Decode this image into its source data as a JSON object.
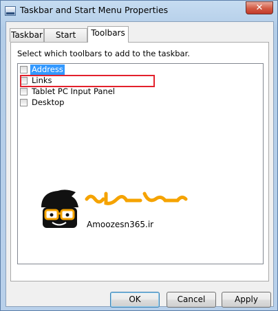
{
  "window": {
    "title": "Taskbar and Start Menu Properties",
    "close_glyph": "✕"
  },
  "tabs": [
    {
      "label": "Taskbar",
      "active": false
    },
    {
      "label": "Start Menu",
      "active": false
    },
    {
      "label": "Toolbars",
      "active": true
    }
  ],
  "toolbars_page": {
    "instruction": "Select which toolbars to add to the taskbar.",
    "items": [
      {
        "label": "Address",
        "checked": false,
        "selected": true
      },
      {
        "label": "Links",
        "checked": false,
        "selected": false
      },
      {
        "label": "Tablet PC Input Panel",
        "checked": false,
        "selected": false
      },
      {
        "label": "Desktop",
        "checked": false,
        "selected": false
      }
    ]
  },
  "watermark": {
    "site": "Amoozesn365.ir"
  },
  "buttons": {
    "ok": "OK",
    "cancel": "Cancel",
    "apply": "Apply"
  },
  "colors": {
    "selection": "#3399ff",
    "highlight_box": "#e3202b",
    "watermark_orange": "#f5a300"
  }
}
